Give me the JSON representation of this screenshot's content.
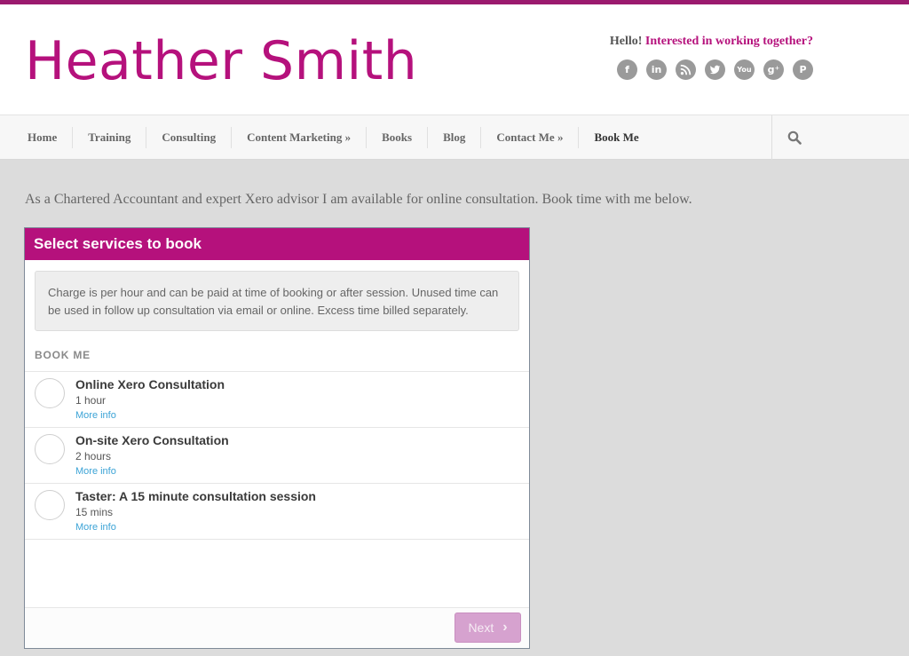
{
  "brand": {
    "name": "Heather Smith",
    "accent": "#b5117c",
    "stripe": "#9b1a6e"
  },
  "header": {
    "hello_text": "Hello!",
    "hello_link": "Interested in working together?",
    "social": [
      {
        "icon": "facebook-icon",
        "glyph": "f"
      },
      {
        "icon": "linkedin-icon",
        "glyph": "in"
      },
      {
        "icon": "rss-icon",
        "glyph": ""
      },
      {
        "icon": "twitter-icon",
        "glyph": ""
      },
      {
        "icon": "youtube-icon",
        "glyph": "You"
      },
      {
        "icon": "google-plus-icon",
        "glyph": "g⁺"
      },
      {
        "icon": "pinterest-icon",
        "glyph": "P"
      }
    ]
  },
  "nav": {
    "items": [
      {
        "label": "Home"
      },
      {
        "label": "Training"
      },
      {
        "label": "Consulting"
      },
      {
        "label": "Content Marketing »"
      },
      {
        "label": "Books"
      },
      {
        "label": "Blog"
      },
      {
        "label": "Contact Me »"
      },
      {
        "label": "Book Me",
        "active": true
      }
    ],
    "search_icon": "search-icon"
  },
  "main": {
    "intro": "As a Chartered Accountant and expert Xero advisor I am available for online consultation. Book time with me below."
  },
  "booking": {
    "title": "Select services to book",
    "notice": "Charge is per hour and can be paid at time of booking or after session. Unused time can be used in follow up consultation via email or online. Excess time billed separately.",
    "section_label": "BOOK ME",
    "services": [
      {
        "name": "Online Xero Consultation",
        "duration": "1 hour",
        "more": "More info"
      },
      {
        "name": "On-site Xero Consultation",
        "duration": "2 hours",
        "more": "More info"
      },
      {
        "name": "Taster: A 15 minute consultation session",
        "duration": "15 mins",
        "more": "More info"
      }
    ],
    "next_label": "Next"
  }
}
